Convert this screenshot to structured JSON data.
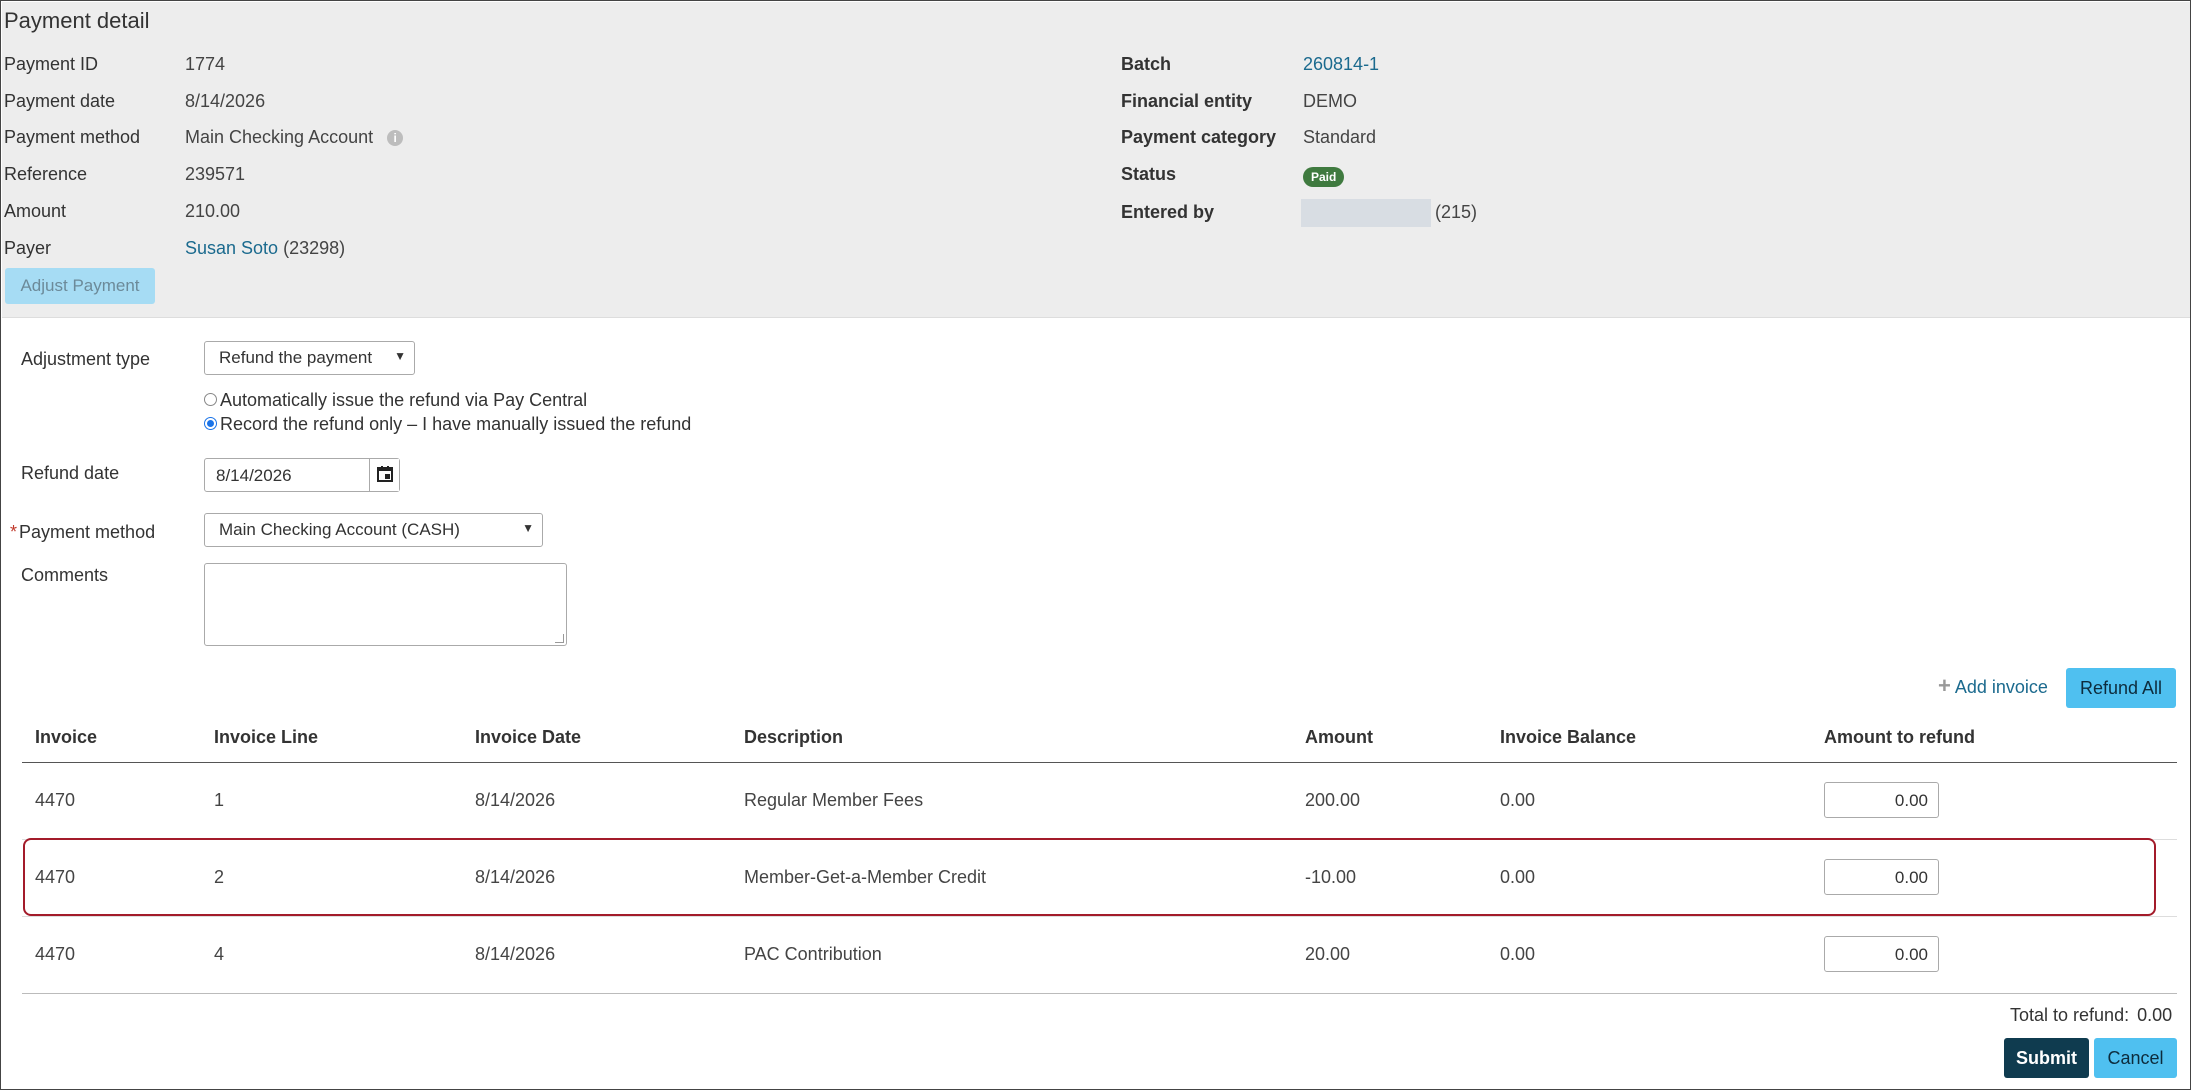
{
  "detail": {
    "title": "Payment detail",
    "left_fields": [
      {
        "label": "Payment ID",
        "value": "1774"
      },
      {
        "label": "Payment date",
        "value": "8/14/2026"
      },
      {
        "label": "Payment method",
        "value": "Main Checking Account"
      },
      {
        "label": "Reference",
        "value": "239571"
      },
      {
        "label": "Amount",
        "value": "210.00"
      },
      {
        "label": "Payer",
        "value_link": "Susan Soto",
        "value_suffix": "(23298)"
      }
    ],
    "right_fields": [
      {
        "label": "Batch",
        "value": "260814-1"
      },
      {
        "label": "Financial entity",
        "value": "DEMO"
      },
      {
        "label": "Payment category",
        "value": "Standard"
      },
      {
        "label": "Status",
        "value": "Paid"
      },
      {
        "label": "Entered by",
        "value": "(215)"
      }
    ],
    "info_icon": "info-icon",
    "adjust_button": "Adjust Payment"
  },
  "form": {
    "adjustment_type_label": "Adjustment type",
    "adjustment_type_value": "Refund the payment",
    "radio_auto": "Automatically issue the refund via Pay Central",
    "radio_manual": "Record the refund only – I have manually issued the refund",
    "refund_date_label": "Refund date",
    "refund_date_value": "8/14/2026",
    "required_mark": "*",
    "payment_method_label": "Payment method",
    "payment_method_value": "Main Checking Account (CASH)",
    "comments_label": "Comments",
    "comments_value": ""
  },
  "table": {
    "add_invoice": "Add invoice",
    "refund_all": "Refund All",
    "headers": [
      "Invoice",
      "Invoice Line",
      "Invoice Date",
      "Description",
      "Amount",
      "Invoice Balance",
      "Amount to refund"
    ],
    "rows": [
      {
        "invoice": "4470",
        "line": "1",
        "date": "8/14/2026",
        "description": "Regular Member Fees",
        "amount": "200.00",
        "balance": "0.00",
        "refund": "0.00"
      },
      {
        "invoice": "4470",
        "line": "2",
        "date": "8/14/2026",
        "description": "Member-Get-a-Member Credit",
        "amount": "-10.00",
        "balance": "0.00",
        "refund": "0.00"
      },
      {
        "invoice": "4470",
        "line": "4",
        "date": "8/14/2026",
        "description": "PAC Contribution",
        "amount": "20.00",
        "balance": "0.00",
        "refund": "0.00"
      }
    ],
    "total_label": "Total to refund:",
    "total_value": "0.00"
  },
  "actions": {
    "submit": "Submit",
    "cancel": "Cancel"
  },
  "colors": {
    "panel_bg": "#ededed",
    "link": "#1b6a8e",
    "accent_button": "#4fc0f0",
    "submit_button": "#0f3b4f",
    "status_paid": "#3f7a3f",
    "highlight_border": "#a31b2a"
  }
}
